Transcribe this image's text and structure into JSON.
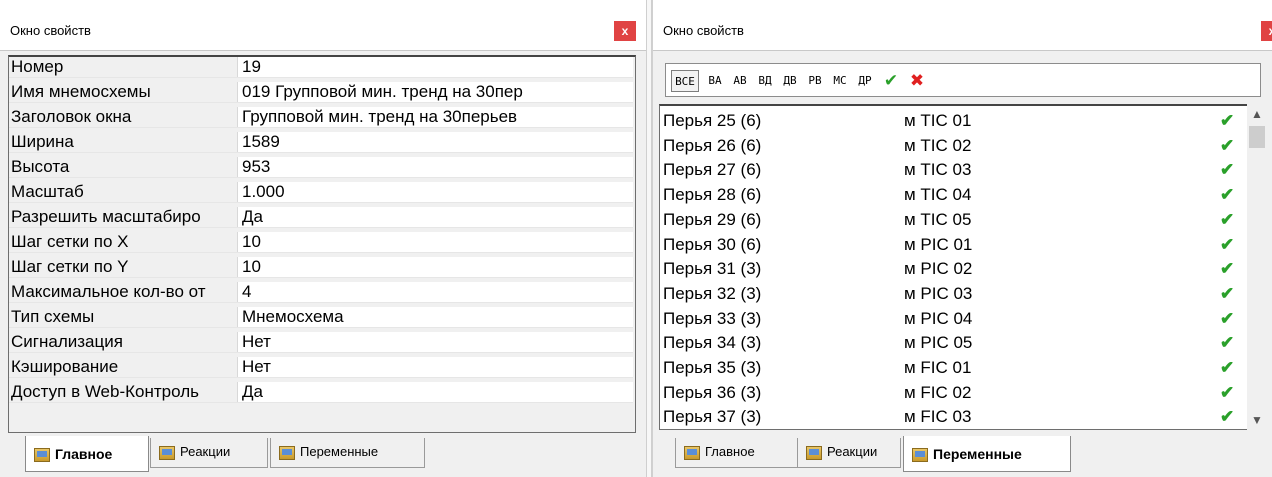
{
  "left_panel": {
    "title": "Окно свойств",
    "close_label": "x",
    "properties": [
      {
        "name": "Номер",
        "value": "19"
      },
      {
        "name": "Имя мнемосхемы",
        "value": "019 Групповой мин. тренд на 30пер"
      },
      {
        "name": "Заголовок окна",
        "value": "Групповой мин. тренд на 30перьев"
      },
      {
        "name": "Ширина",
        "value": "1589"
      },
      {
        "name": "Высота",
        "value": "953"
      },
      {
        "name": "Масштаб",
        "value": "1.000"
      },
      {
        "name": "Разрешить масштабиро",
        "value": "Да"
      },
      {
        "name": "Шаг сетки по X",
        "value": "10"
      },
      {
        "name": "Шаг сетки по Y",
        "value": "10"
      },
      {
        "name": "Максимальное кол-во от",
        "value": "4"
      },
      {
        "name": "Тип схемы",
        "value": "Мнемосхема"
      },
      {
        "name": "Сигнализация",
        "value": "Нет"
      },
      {
        "name": "Кэширование",
        "value": "Нет"
      },
      {
        "name": "Доступ в Web-Контроль",
        "value": "Да"
      }
    ],
    "tabs": [
      {
        "label": "Главное",
        "active": true
      },
      {
        "label": "Реакции",
        "active": false
      },
      {
        "label": "Переменные",
        "active": false
      }
    ]
  },
  "right_panel": {
    "title": "Окно свойств",
    "close_label": "x",
    "toolbar": {
      "filters": [
        "ВСЕ",
        "ВА",
        "АВ",
        "ВД",
        "ДВ",
        "РВ",
        "МС",
        "ДР"
      ],
      "check_all_icon": "check-mark-icon",
      "uncheck_all_icon": "red-cross-icon"
    },
    "variables": [
      {
        "name": "Перья 25 (6)",
        "value": "м TIC 01",
        "checked": true
      },
      {
        "name": "Перья 26 (6)",
        "value": "м TIC 02",
        "checked": true
      },
      {
        "name": "Перья 27 (6)",
        "value": "м TIC 03",
        "checked": true
      },
      {
        "name": "Перья 28 (6)",
        "value": "м TIC 04",
        "checked": true
      },
      {
        "name": "Перья 29 (6)",
        "value": "м TIC 05",
        "checked": true
      },
      {
        "name": "Перья 30 (6)",
        "value": "м PIC 01",
        "checked": true
      },
      {
        "name": "Перья 31 (3)",
        "value": "м PIC 02",
        "checked": true
      },
      {
        "name": "Перья 32 (3)",
        "value": "м PIC 03",
        "checked": true
      },
      {
        "name": "Перья 33 (3)",
        "value": "м PIC 04",
        "checked": true
      },
      {
        "name": "Перья 34 (3)",
        "value": "м PIC 05",
        "checked": true
      },
      {
        "name": "Перья 35 (3)",
        "value": "м FIC 01",
        "checked": true
      },
      {
        "name": "Перья 36 (3)",
        "value": "м FIC 02",
        "checked": true
      },
      {
        "name": "Перья 37 (3)",
        "value": "м FIC 03",
        "checked": true
      }
    ],
    "tabs": [
      {
        "label": "Главное",
        "active": false
      },
      {
        "label": "Реакции",
        "active": false
      },
      {
        "label": "Переменные",
        "active": true
      }
    ]
  },
  "colors": {
    "check": "#2aa02a",
    "close": "#e04343",
    "cross": "#e02020"
  }
}
